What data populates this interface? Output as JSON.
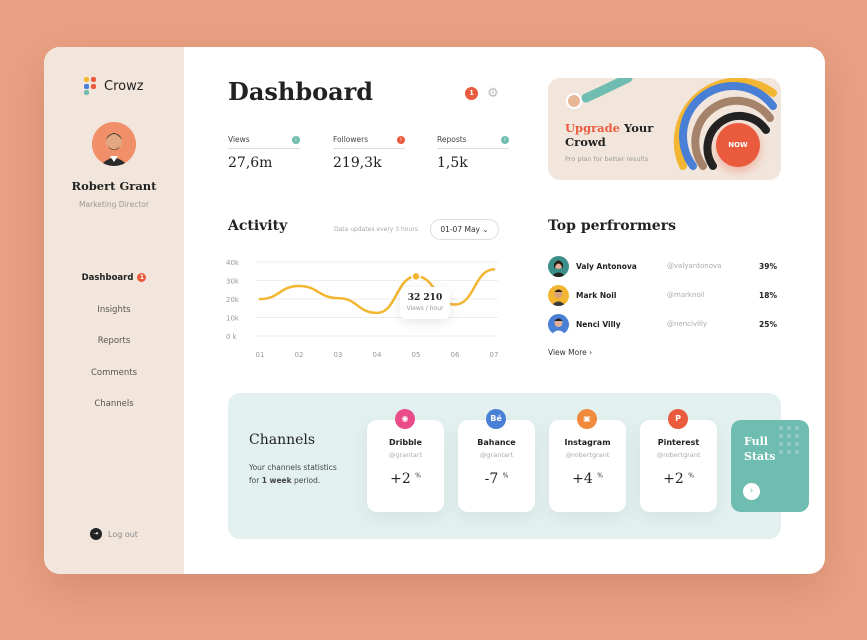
{
  "app": {
    "name": "Crowz"
  },
  "user": {
    "name": "Robert Grant",
    "role": "Marketing Director"
  },
  "nav": {
    "items": [
      {
        "label": "Dashboard",
        "badge": "1"
      },
      {
        "label": "Insights"
      },
      {
        "label": "Reports"
      },
      {
        "label": "Comments"
      },
      {
        "label": "Channels"
      }
    ],
    "logout": "Log out"
  },
  "header": {
    "title": "Dashboard",
    "notifications": "1"
  },
  "stats": [
    {
      "label": "Views",
      "value": "27,6m",
      "color": "#6fbcb0"
    },
    {
      "label": "Followers",
      "value": "219,3k",
      "color": "#ea5a3d"
    },
    {
      "label": "Reposts",
      "value": "1,5k",
      "color": "#6fbcb0"
    }
  ],
  "upgrade": {
    "title_accent": "Upgrade",
    "title_rest": "Your",
    "title_line2": "Crowd",
    "subtitle": "Pro plan for better results",
    "button": "NOW"
  },
  "activity": {
    "title": "Activity",
    "note": "Data updates every 3 hours",
    "range": "01-07 May",
    "tooltip_value": "32 210",
    "tooltip_label": "Views / hour"
  },
  "chart_data": {
    "type": "line",
    "categories": [
      "01",
      "02",
      "03",
      "04",
      "05",
      "06",
      "07"
    ],
    "series": [
      {
        "values": [
          20000,
          27000,
          20500,
          12500,
          32210,
          17000,
          36000
        ]
      }
    ],
    "y_ticks": [
      "40k",
      "30k",
      "20k",
      "10k",
      "0 k"
    ],
    "ylim": [
      0,
      40000
    ],
    "highlight_index": 4,
    "color": "#f2b632",
    "grid": true
  },
  "performers": {
    "title": "Top perfrormers",
    "items": [
      {
        "name": "Valy Antonova",
        "handle": "@valyantonova",
        "pct": "39%"
      },
      {
        "name": "Mark Noil",
        "handle": "@marknoil",
        "pct": "18%"
      },
      {
        "name": "Nenci Villy",
        "handle": "@nencivilly",
        "pct": "25%"
      }
    ],
    "view_more": "View More"
  },
  "channels": {
    "title": "Channels",
    "desc_pre": "Your channels statistics for ",
    "desc_bold": "1 week",
    "desc_post": " period.",
    "items": [
      {
        "name": "Dribble",
        "handle": "@grantart",
        "value": "+2",
        "unit": "%",
        "color": "#ea4c89",
        "icon": "dribbble-icon"
      },
      {
        "name": "Bahance",
        "handle": "@grantart",
        "value": "-7",
        "unit": "%",
        "color": "#4a7fd6",
        "icon": "behance-icon"
      },
      {
        "name": "Instagram",
        "handle": "@robertgrant",
        "value": "+4",
        "unit": "%",
        "color": "#f08a3c",
        "icon": "instagram-icon"
      },
      {
        "name": "Pinterest",
        "handle": "@robertgrant",
        "value": "+2",
        "unit": "%",
        "color": "#ea5a3d",
        "icon": "pinterest-icon"
      }
    ],
    "full_stats": "Full Stats"
  }
}
